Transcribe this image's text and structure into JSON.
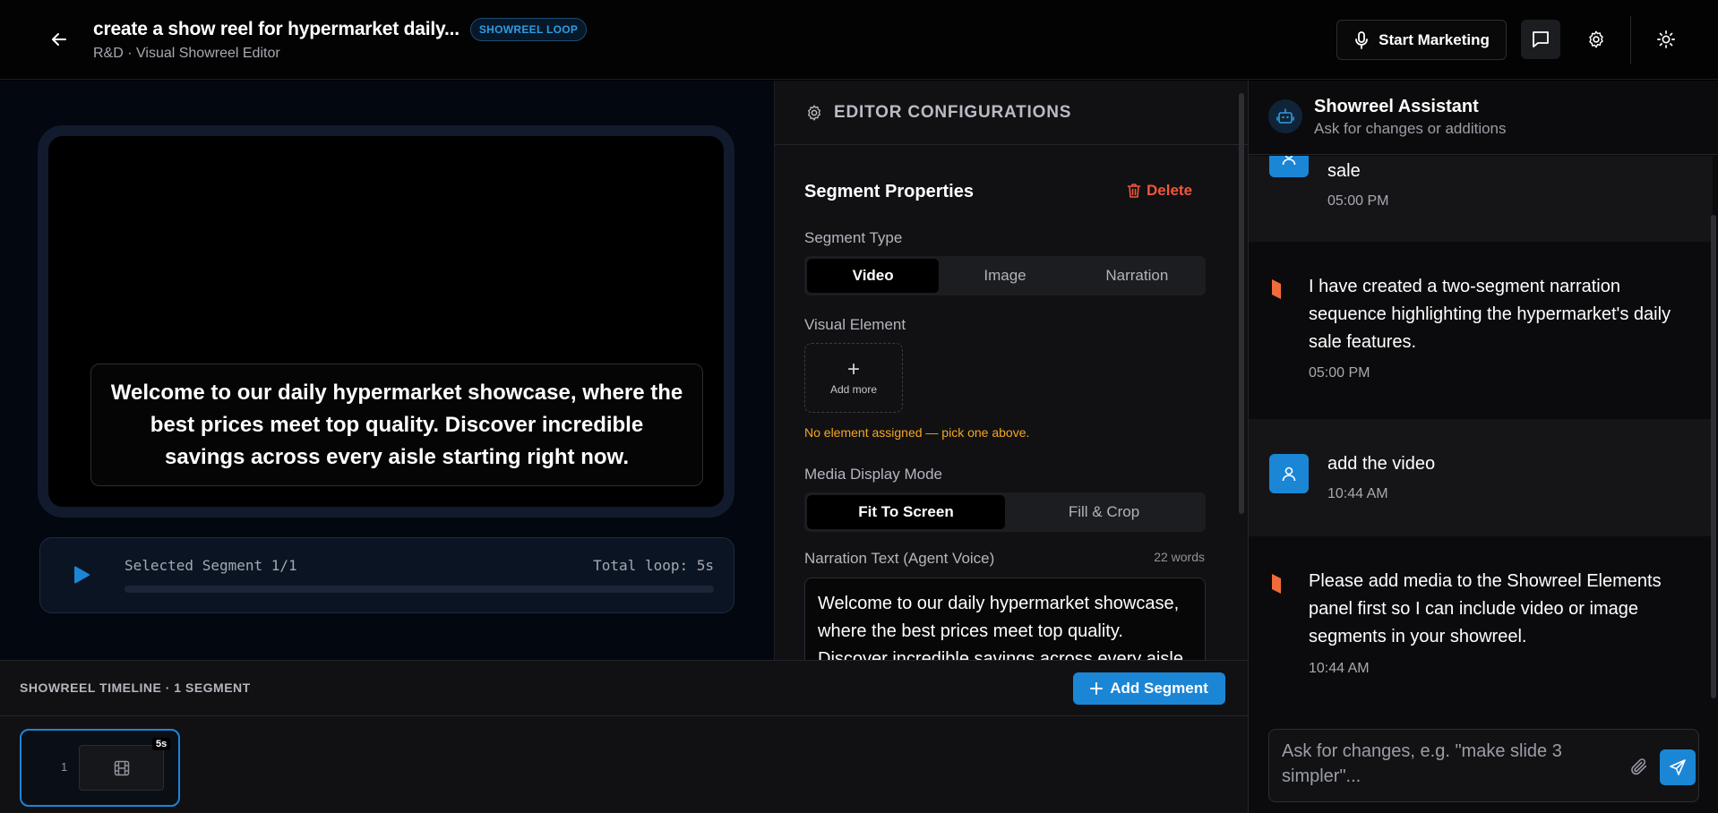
{
  "header": {
    "title": "create a show reel for hypermarket daily...",
    "badge": "SHOWREEL LOOP",
    "subtitle": "R&D · Visual Showreel Editor",
    "start_button": "Start Marketing"
  },
  "preview": {
    "caption": "Welcome to our daily hypermarket showcase, where the best prices meet top quality. Discover incredible savings across every aisle starting right now.",
    "selected_segment": "Selected Segment 1/1",
    "total_loop": "Total loop: 5s",
    "progress": 0
  },
  "editor": {
    "heading": "EDITOR CONFIGURATIONS",
    "section_title": "Segment Properties",
    "delete_label": "Delete",
    "segment_type_label": "Segment Type",
    "segment_types": [
      "Video",
      "Image",
      "Narration"
    ],
    "segment_type_selected": "Video",
    "visual_element_label": "Visual Element",
    "add_more_label": "Add more",
    "warning": "No element assigned — pick one above.",
    "media_display_label": "Media Display Mode",
    "media_modes": [
      "Fit To Screen",
      "Fill & Crop"
    ],
    "media_mode_selected": "Fit To Screen",
    "narration_label": "Narration Text (Agent Voice)",
    "word_count": "22 words",
    "narration_text": "Welcome to our daily hypermarket showcase, where the best prices meet top quality. Discover incredible savings across every aisle starting right now."
  },
  "timeline": {
    "title": "SHOWREEL TIMELINE · 1 SEGMENT",
    "add_button": "Add Segment",
    "segments": [
      {
        "number": "1",
        "duration": "5s",
        "icon": "film-icon"
      }
    ]
  },
  "assistant": {
    "name": "Showreel Assistant",
    "subtitle": "Ask for changes or additions",
    "messages": [
      {
        "role": "user",
        "text": "sale",
        "time": "05:00 PM"
      },
      {
        "role": "assistant",
        "text": "I have created a two-segment narration sequence highlighting the hypermarket's daily sale features.",
        "time": "05:00 PM"
      },
      {
        "role": "user",
        "text": "add the video",
        "time": "10:44 AM"
      },
      {
        "role": "assistant",
        "text": "Please add media to the Showreel Elements panel first so I can include video or image segments in your showreel.",
        "time": "10:44 AM"
      }
    ],
    "input_placeholder": "Ask for changes, e.g. \"make slide 3 simpler\"..."
  },
  "colors": {
    "accent": "#1b86d6",
    "danger": "#f0563c",
    "warning": "#f5a61e",
    "bot_mark": "#f26b3a"
  }
}
